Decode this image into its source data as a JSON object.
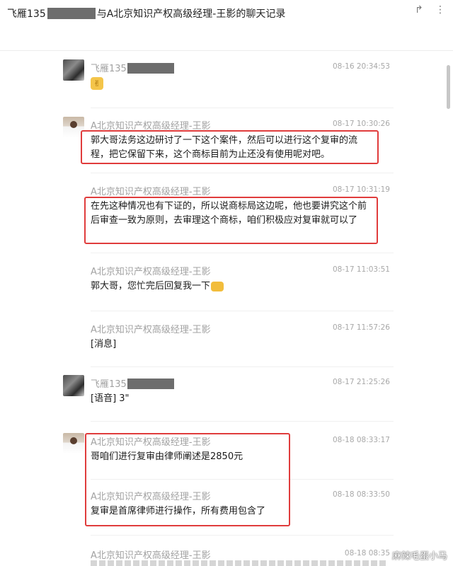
{
  "window": {
    "title_prefix": "飞雁135",
    "title_suffix": "与A北京知识产权高级经理-王影的聊天记录"
  },
  "messages": [
    {
      "sender": "飞雁135",
      "time": "08-16 20:34:53",
      "avatar": "photo",
      "text": "",
      "emoji": "hands-icon"
    },
    {
      "sender": "A北京知识产权高级经理-王影",
      "time": "08-17 10:30:26",
      "avatar": "person",
      "text": "郭大哥法务这边研讨了一下这个案件，然后可以进行这个复审的流程，把它保留下来，这个商标目前为止还没有使用呢对吧。"
    },
    {
      "sender": "A北京知识产权高级经理-王影",
      "time": "08-17 10:31:19",
      "text": "在先这种情况也有下证的，所以说商标局这边呢，他也要讲究这个前后审查一致为原则，去审理这个商标，咱们积极应对复审就可以了"
    },
    {
      "sender": "A北京知识产权高级经理-王影",
      "time": "08-17 11:03:51",
      "text": "郭大哥，您忙完后回复我一下",
      "emoji": "handshake-icon"
    },
    {
      "sender": "A北京知识产权高级经理-王影",
      "time": "08-17 11:57:26",
      "text": "[消息]"
    },
    {
      "sender": "飞雁135",
      "time": "08-17 21:25:26",
      "avatar": "photo",
      "text": "[语音] 3\""
    },
    {
      "sender": "A北京知识产权高级经理-王影",
      "time": "08-18 08:33:17",
      "avatar": "person",
      "text": "哥咱们进行复审由律师阐述是2850元"
    },
    {
      "sender": "A北京知识产权高级经理-王影",
      "time": "08-18 08:33:50",
      "text": "复审是首席律师进行操作，所有费用包含了"
    },
    {
      "sender": "A北京知识产权高级经理-王影",
      "time": "08-18 08:35",
      "text": ""
    }
  ],
  "watermark": "麻辣毛蛋小马",
  "colors": {
    "highlight": "#e03c3c",
    "meta_text": "#a2a2a2"
  }
}
